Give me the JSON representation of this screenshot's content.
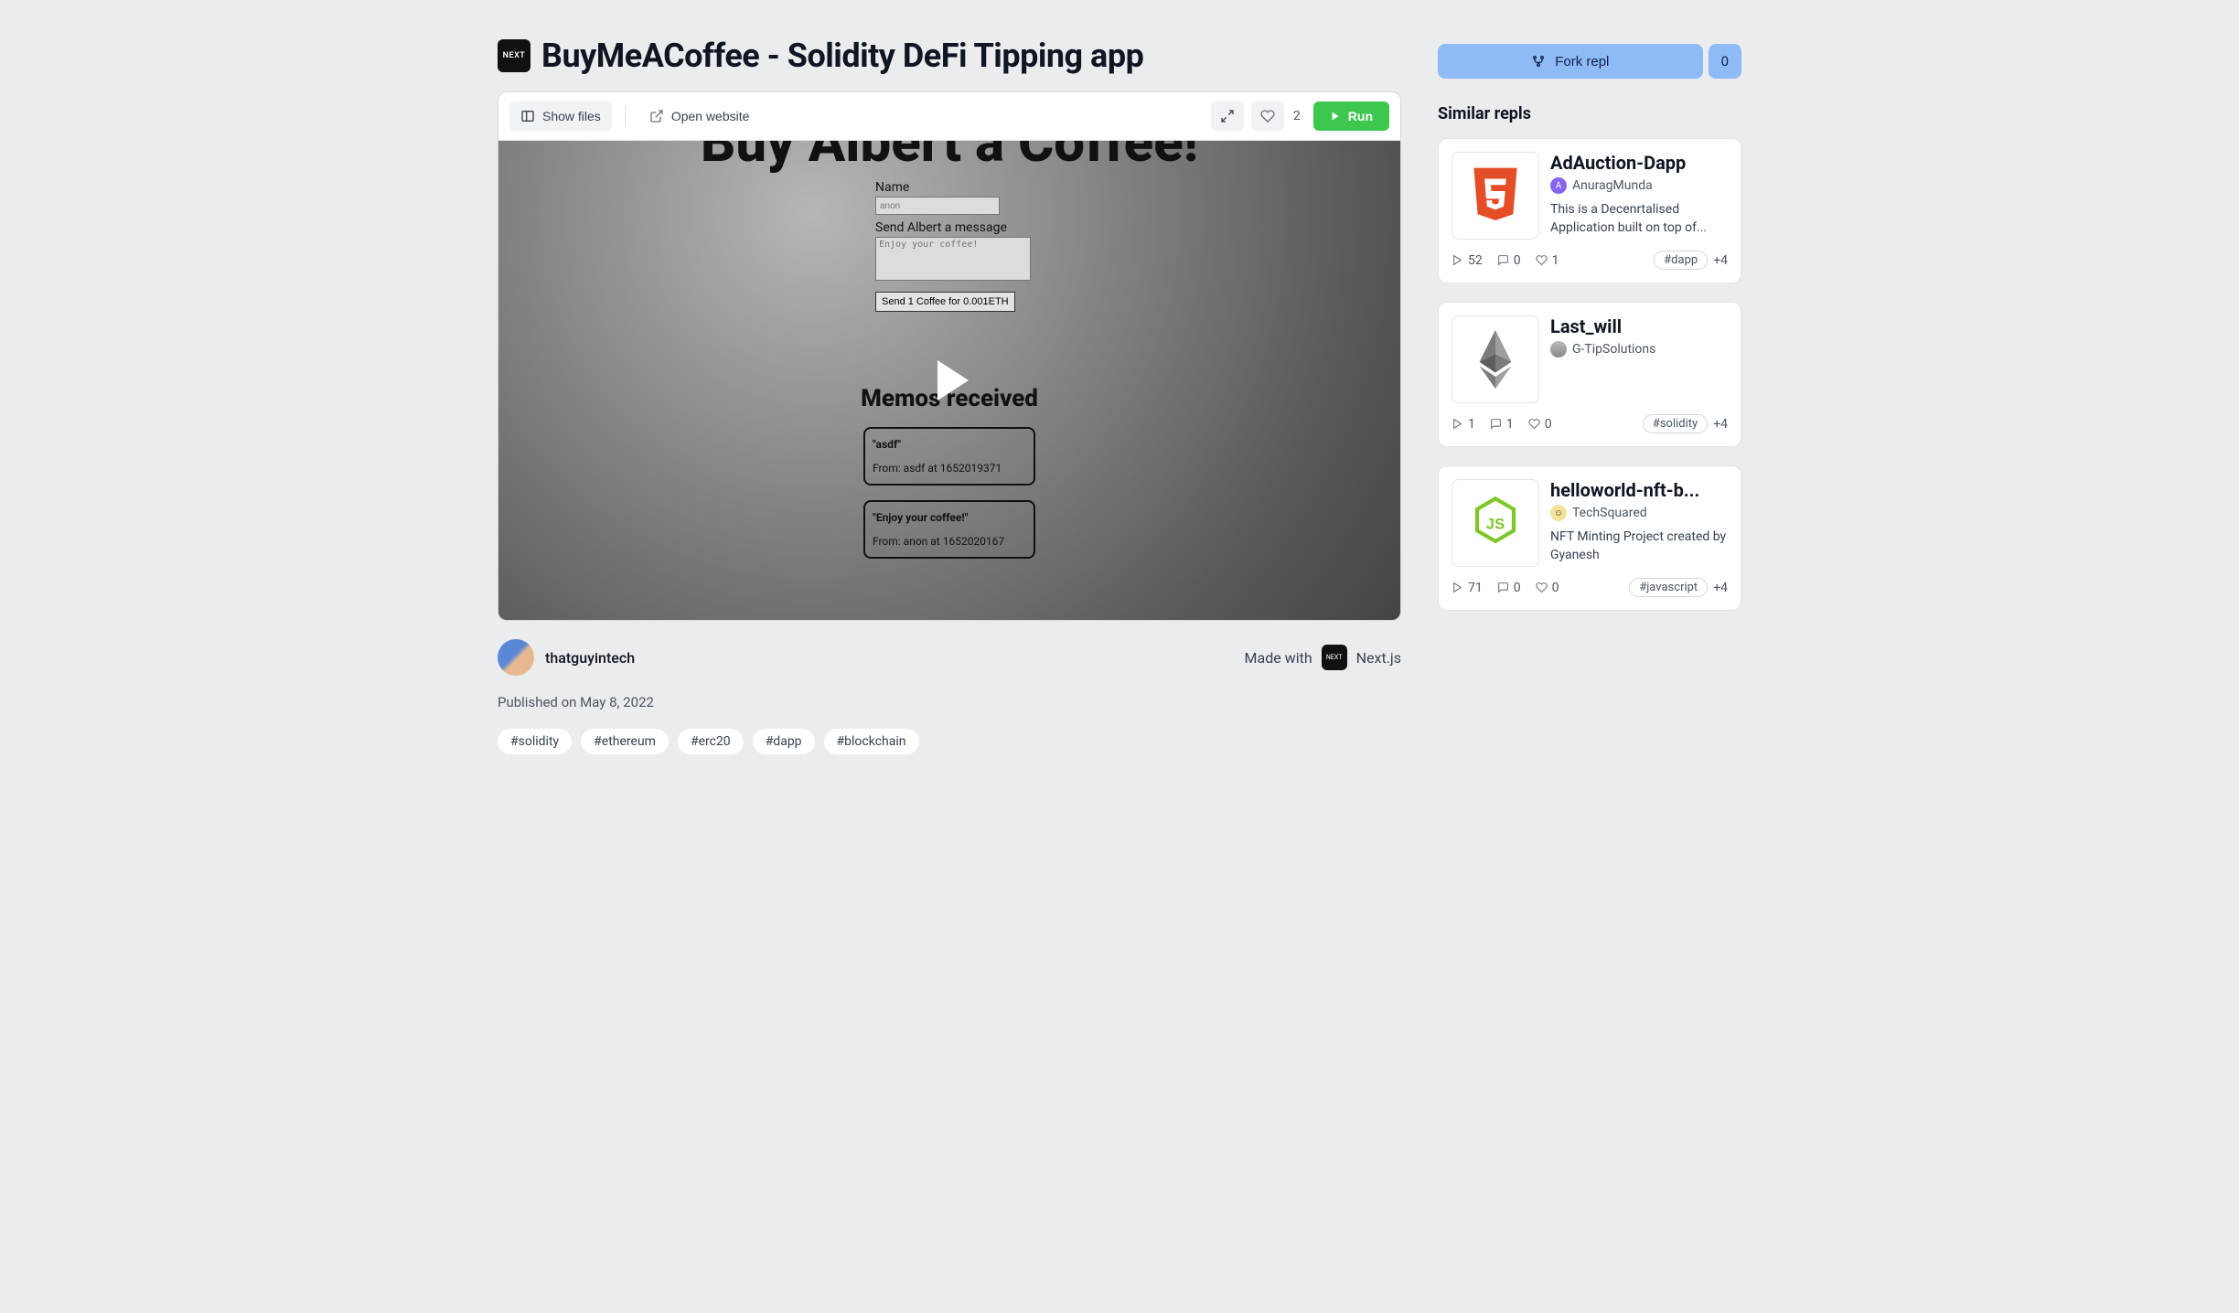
{
  "title": "BuyMeACoffee - Solidity DeFi Tipping app",
  "toolbar": {
    "show_files": "Show files",
    "open_website": "Open website",
    "likes": "2",
    "run": "Run"
  },
  "preview": {
    "big_title": "Buy Albert a Coffee!",
    "name_label": "Name",
    "name_placeholder": "anon",
    "msg_label": "Send Albert a message",
    "msg_placeholder": "Enjoy your coffee!",
    "send_button": "Send 1 Coffee for 0.001ETH",
    "memos_title": "Memos received",
    "memos": [
      {
        "msg": "\"asdf\"",
        "from": "From: asdf at 1652019371"
      },
      {
        "msg": "\"Enjoy your coffee!\"",
        "from": "From: anon at 1652020167"
      }
    ]
  },
  "author": {
    "name": "thatguyintech"
  },
  "made_with": {
    "label": "Made with",
    "name": "Next.js"
  },
  "published": "Published on May 8, 2022",
  "tags": [
    "#solidity",
    "#ethereum",
    "#erc20",
    "#dapp",
    "#blockchain"
  ],
  "fork": {
    "label": "Fork repl",
    "count": "0"
  },
  "similar_title": "Similar repls",
  "similar": [
    {
      "title": "AdAuction-Dapp",
      "author": "AnuragMunda",
      "author_color": "#8664f0",
      "author_letter": "A",
      "desc": "This is a Decenrtalised Application built on top of...",
      "runs": "52",
      "comments": "0",
      "likes": "1",
      "tag": "#dapp",
      "more": "+4",
      "icon": "html5"
    },
    {
      "title": "Last_will",
      "author": "G-TipSolutions",
      "author_color": "#999",
      "author_letter": "",
      "desc": "",
      "runs": "1",
      "comments": "1",
      "likes": "0",
      "tag": "#solidity",
      "more": "+4",
      "icon": "eth"
    },
    {
      "title": "helloworld-nft-b...",
      "author": "TechSquared",
      "author_color": "#f4e29a",
      "author_letter": "",
      "desc": "NFT Minting Project created by Gyanesh",
      "runs": "71",
      "comments": "0",
      "likes": "0",
      "tag": "#javascript",
      "more": "+4",
      "icon": "node"
    }
  ]
}
